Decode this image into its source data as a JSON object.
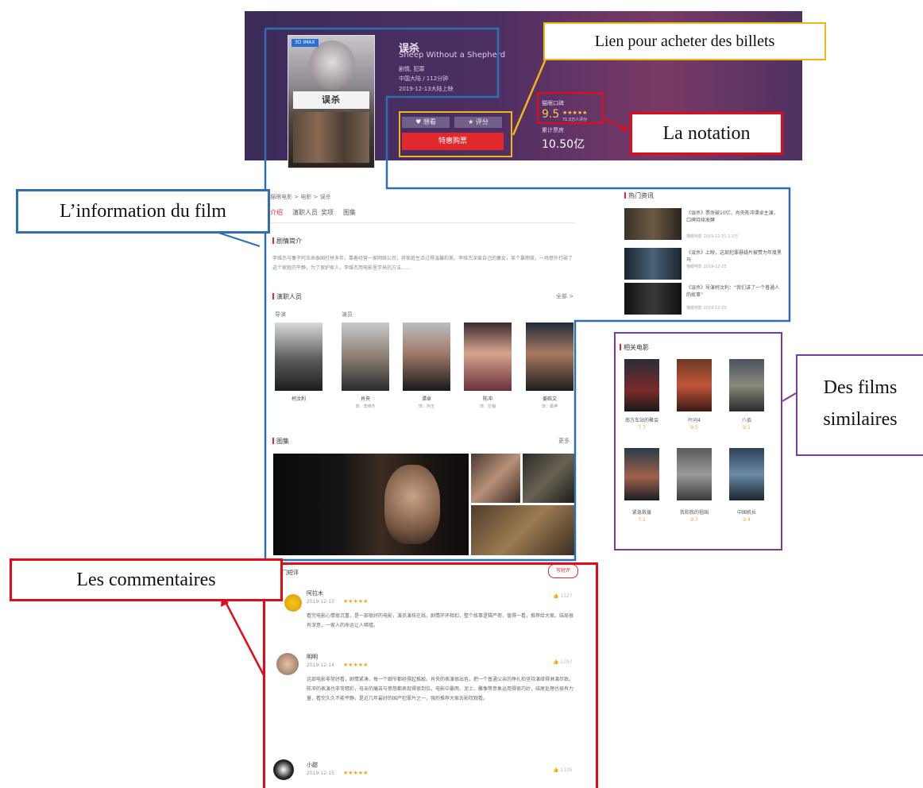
{
  "annotations": {
    "ticket_link": "Lien pour acheter des billets",
    "rating": "La notation",
    "film_info": "L’information du film",
    "similar_films_line1": "Des films",
    "similar_films_line2": "similaires",
    "comments": "Les commentaires"
  },
  "colors": {
    "blue_box": "#2f6fae",
    "yellow_box": "#f1b517",
    "red_box": "#e10b1a",
    "purple_box": "#7a3aa0",
    "header_bg": "#4a2f63",
    "buy_button": "#e1282c"
  },
  "movie": {
    "imax_badge": "3D IMAX",
    "poster_title": "误杀",
    "title": "误杀",
    "english_title": "Sheep Without a Shepherd",
    "genre": "剧情, 犯罪",
    "length": "中国大陆 / 112分钟",
    "release": "2019-12-13大陆上映",
    "want_label": "想看",
    "rate_label": "评分",
    "buy_label": "特惠购票",
    "score_label": "猫眼口碑",
    "score": "9.5",
    "score_stars": "★★★★★",
    "score_count": "71.5万人评分",
    "box_label": "累计票房",
    "box_value": "10.50亿"
  },
  "detail": {
    "breadcrumb": "猫眼电影 > 电影 > 误杀",
    "tabs": [
      "介绍",
      "演职人员",
      "奖项",
      "图集"
    ],
    "intro_heading": "剧情简介",
    "intro_text": "李维杰与妻子阿玉来泰国打拼多年，靠着经营一家网络公司，将家庭生活过得温馨和美。李维杰深爱自己的妻女，某个暴雨夜，一场意外打破了这个家庭的平静，为了保护家人，李维杰用电影里学来的方法……",
    "cast_heading": "演职人员",
    "cast_more": "全部 >",
    "role_director": "导演",
    "role_actor": "演员",
    "people": [
      {
        "name": "柯汶利",
        "role": ""
      },
      {
        "name": "肖央",
        "role": "饰：李维杰"
      },
      {
        "name": "谭卓",
        "role": "饰：阿玉"
      },
      {
        "name": "陈冲",
        "role": "饰：拉韫"
      },
      {
        "name": "姜皓文",
        "role": "饰：桑坤"
      }
    ],
    "photos_heading": "图集",
    "photos_more": "更多"
  },
  "news": {
    "heading": "热门资讯",
    "items": [
      {
        "text": "《误杀》票房破10亿，肖央陈冲谭卓主演，口碑持续发酵",
        "meta": "猫眼电影 2019-12-31  1.2万"
      },
      {
        "text": "《误杀》上映，这部犯罪悬疑片被赞为年度黑马",
        "meta": "猫眼电影 2019-12-25"
      },
      {
        "text": "《误杀》导演柯汶利：“我们讲了一个普通人的故事”",
        "meta": "猫眼电影 2019-12-20"
      }
    ]
  },
  "similar": {
    "heading": "相关电影",
    "films": [
      {
        "name": "南方车站的聚会",
        "score": "7.7"
      },
      {
        "name": "叶问4",
        "score": "9.0"
      },
      {
        "name": "八佰",
        "score": "9.1"
      },
      {
        "name": "紧急救援",
        "score": "7.1"
      },
      {
        "name": "我和我的祖国",
        "score": "9.7"
      },
      {
        "name": "中国机长",
        "score": "9.4"
      }
    ]
  },
  "comments": {
    "heading": "热门短评",
    "write_label": "写短评",
    "items": [
      {
        "user": "阿拉木",
        "date": "2019-12-13",
        "stars": "★★★★★",
        "likes": "1527",
        "text": "看完电影心情很沉重，是一部很好的电影，演员演技在线，剧情环环相扣，整个故事逻辑严密，值得一看，推荐给大家。结局很有深意，一家人的命运让人唏嘘。"
      },
      {
        "user": "明明",
        "date": "2019-12-14",
        "stars": "★★★★★",
        "likes": "1297",
        "text": "这部电影非常好看，剧情紧凑，每一个细节都经得起推敲。肖央的表演很出色，把一个普通父亲的挣扎和坚持演绎得淋漓尽致。陈冲的表演也非常精彩，母亲的痛苦与愤怒都表现得很到位。电影中暴雨、泥土、雕像等意象运用得很巧妙，结尾处理也很有力量，看完久久不能平静，是近几年最好的国产犯罪片之一，强烈推荐大家去影院观看。"
      },
      {
        "user": "小甜",
        "date": "2019-12-15",
        "stars": "★★★★★",
        "likes": "1105",
        "text": ""
      }
    ]
  }
}
